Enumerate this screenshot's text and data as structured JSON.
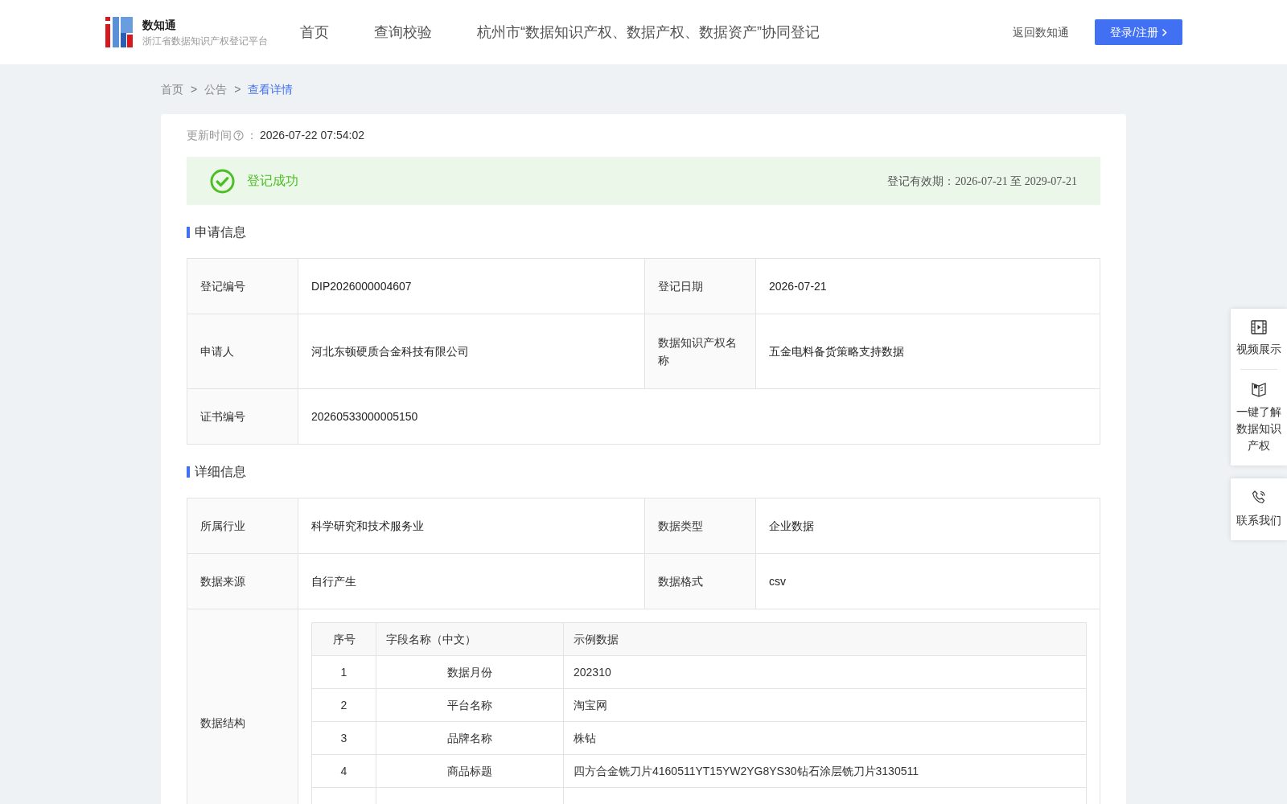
{
  "header": {
    "brand": "数知通",
    "subtitle": "浙江省数据知识产权登记平台",
    "nav": [
      {
        "label": "首页"
      },
      {
        "label": "查询校验"
      },
      {
        "label": "杭州市“数据知识产权、数据产权、数据资产”协同登记"
      }
    ],
    "back_link": "返回数知通",
    "login_button": "登录/注册"
  },
  "breadcrumb": [
    {
      "label": "首页",
      "current": false
    },
    {
      "label": "公告",
      "current": false
    },
    {
      "label": "查看详情",
      "current": true
    }
  ],
  "breadcrumb_separator": ">",
  "update": {
    "label": "更新时间",
    "colon": "：",
    "value": "2026-07-22 07:54:02"
  },
  "status": {
    "text": "登记成功",
    "validity": "登记有效期：2026-07-21 至 2029-07-21"
  },
  "sections": [
    {
      "title": "申请信息",
      "rows": [
        [
          {
            "label": "登记编号",
            "value": "DIP2026000004607"
          },
          {
            "label": "登记日期",
            "value": "2026-07-21"
          }
        ],
        [
          {
            "label": "申请人",
            "value": "河北东顿硬质合金科技有限公司"
          },
          {
            "label": "数据知识产权名称",
            "value": "五金电料备货策略支持数据"
          }
        ],
        [
          {
            "label": "证书编号",
            "value": "20260533000005150"
          }
        ]
      ]
    },
    {
      "title": "详细信息",
      "rows": [
        [
          {
            "label": "所属行业",
            "value": "科学研究和技术服务业"
          },
          {
            "label": "数据类型",
            "value": "企业数据"
          }
        ],
        [
          {
            "label": "数据来源",
            "value": "自行产生"
          },
          {
            "label": "数据格式",
            "value": "csv"
          }
        ]
      ],
      "structure": {
        "label": "数据结构",
        "columns": [
          "序号",
          "字段名称（中文）",
          "示例数据"
        ],
        "rows": [
          [
            "1",
            "数据月份",
            "202310"
          ],
          [
            "2",
            "平台名称",
            "淘宝网"
          ],
          [
            "3",
            "品牌名称",
            "株钻"
          ],
          [
            "4",
            "商品标题",
            "四方合金铣刀片4160511YT15YW2YG8YS30钻石涂层铣刀片3130511"
          ]
        ]
      }
    }
  ],
  "side_panels": [
    [
      {
        "kind": "video",
        "label": "视频展示"
      },
      {
        "kind": "book",
        "label": "一键了解数据知识产权"
      }
    ],
    [
      {
        "kind": "phone",
        "label": "联系我们"
      }
    ]
  ]
}
